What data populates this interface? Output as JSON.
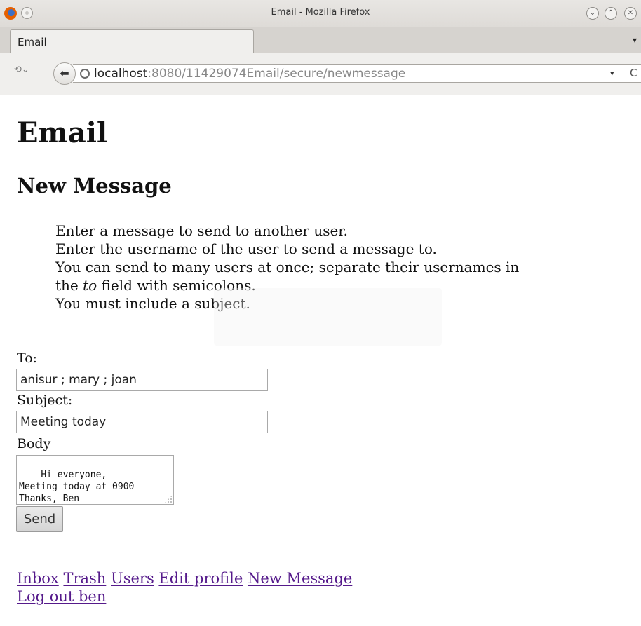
{
  "window": {
    "title": "Email - Mozilla Firefox",
    "buttons": [
      "⌄",
      "⌃",
      "✕"
    ]
  },
  "tab": {
    "label": "Email",
    "menu_glyph": "▾"
  },
  "navbar": {
    "history_glyph": "⟲⌄",
    "back_glyph": "⬅",
    "url_host": "localhost",
    "url_rest": ":8080/11429074Email/secure/newmessage",
    "dropmarker_glyph": "▾",
    "reload_glyph": "C"
  },
  "page": {
    "heading": "Email",
    "subheading": "New Message",
    "instructions": {
      "line1": "Enter a message to send to another user.",
      "line2": "Enter the username of the user to send a message to.",
      "line3": "You can send to many users at once; separate their usernames in",
      "line4_pre": "the ",
      "line4_em": "to",
      "line4_post": " field with semicolons.",
      "line5": "You must include a subject."
    },
    "form": {
      "to_label": "To:",
      "to_value": "anisur ; mary ; joan",
      "subject_label": "Subject:",
      "subject_value": "Meeting today",
      "body_label": "Body",
      "body_value": "Hi everyone,\nMeeting today at 0900\nThanks, Ben",
      "send_label": "Send"
    },
    "links": {
      "inbox": "Inbox",
      "trash": "Trash",
      "users": "Users",
      "edit_profile": "Edit profile",
      "new_message": "New Message",
      "logout": "Log out ben"
    }
  }
}
